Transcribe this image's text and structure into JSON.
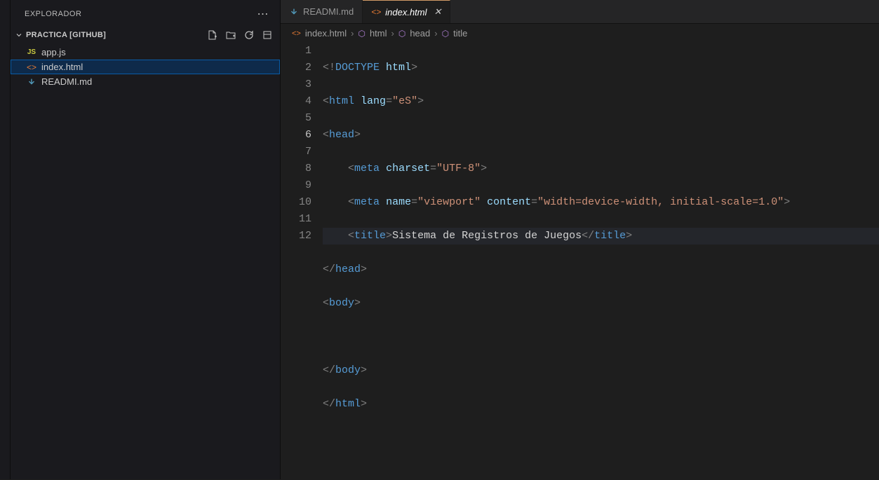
{
  "sidebar": {
    "title": "EXPLORADOR",
    "section": "PRACTICA [GITHUB]",
    "files": [
      {
        "name": "app.js",
        "icon": "js"
      },
      {
        "name": "index.html",
        "icon": "html"
      },
      {
        "name": "READMI.md",
        "icon": "md"
      }
    ]
  },
  "tabs": [
    {
      "label": "READMI.md",
      "icon": "md",
      "active": false
    },
    {
      "label": "index.html",
      "icon": "html",
      "active": true
    }
  ],
  "breadcrumbs": [
    {
      "label": "index.html",
      "kind": "file"
    },
    {
      "label": "html",
      "kind": "element"
    },
    {
      "label": "head",
      "kind": "element"
    },
    {
      "label": "title",
      "kind": "element"
    }
  ],
  "code": {
    "currentLine": 6,
    "lineCount": 12,
    "lines": {
      "l1": "<!DOCTYPE html>",
      "l2": "<html lang=\"eS\">",
      "l3": "<head>",
      "l4": "    <meta charset=\"UTF-8\">",
      "l5": "    <meta name=\"viewport\" content=\"width=device-width, initial-scale=1.0\">",
      "l6": "    <title>Sistema de Registros de Juegos</title>",
      "l7": "</head>",
      "l8": "<body>",
      "l9": "    ",
      "l10": "</body>",
      "l11": "</html>",
      "l12": ""
    },
    "tokens": {
      "doctype_open": "<!",
      "doctype_word": "DOCTYPE",
      "space": " ",
      "html_word": "html",
      "gt": ">",
      "lt": "<",
      "lts": "</",
      "lang_attr": "lang",
      "eq": "=",
      "lang_val": "\"eS\"",
      "head": "head",
      "meta": "meta",
      "charset_attr": "charset",
      "charset_val": "\"UTF-8\"",
      "name_attr": "name",
      "viewport_val": "\"viewport\"",
      "content_attr": "content",
      "content_val": "\"width=device-width, initial-scale=1.0\"",
      "title": "title",
      "title_text": "Sistema de Registros de Juegos",
      "body": "body",
      "indent": "    "
    }
  }
}
